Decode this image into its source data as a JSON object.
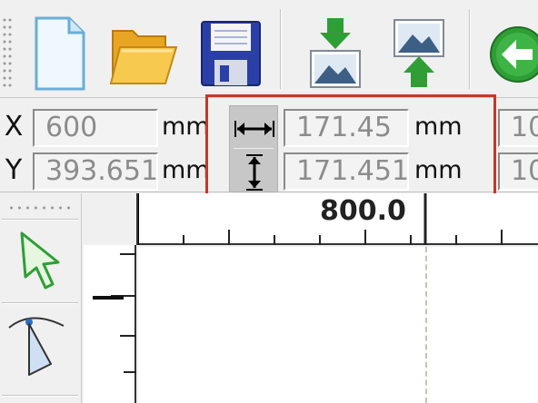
{
  "toolbar": {
    "buttons": [
      {
        "name": "new-document",
        "icon": "new-file-icon"
      },
      {
        "name": "open",
        "icon": "folder-open-icon"
      },
      {
        "name": "save",
        "icon": "floppy-disk-icon"
      },
      {
        "name": "import",
        "icon": "import-image-icon"
      },
      {
        "name": "export",
        "icon": "export-image-icon"
      },
      {
        "name": "back",
        "icon": "back-arrow-icon"
      }
    ]
  },
  "position": {
    "x_label": "X",
    "y_label": "Y",
    "x_value": "600",
    "y_value": "393.651",
    "x_unit": "mm",
    "y_unit": "mm"
  },
  "size": {
    "width_icon": "horizontal-resize-icon",
    "height_icon": "vertical-resize-icon",
    "width_value": "171.45",
    "height_value": "171.451",
    "width_unit": "mm",
    "height_unit": "mm"
  },
  "scale": {
    "x_value": "10",
    "y_value": "10"
  },
  "rulers": {
    "top_label": "800.0",
    "left_label": ""
  },
  "toolbox": {
    "tools": [
      {
        "name": "pick-tool",
        "icon": "pointer-arrow-icon"
      },
      {
        "name": "shape-tool",
        "icon": "node-shape-icon"
      }
    ]
  },
  "colors": {
    "highlight": "#c0392b",
    "arrow_green": "#2e9e35",
    "save_blue": "#2b3fa8",
    "folder_yellow": "#f2b632"
  }
}
